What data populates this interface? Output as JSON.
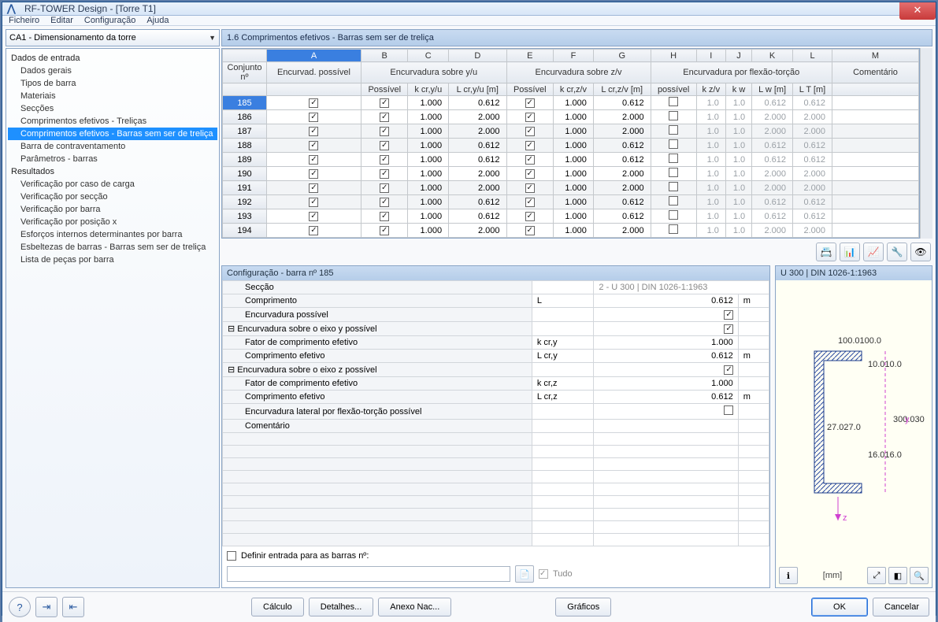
{
  "window": {
    "title": "RF-TOWER Design - [Torre T1]"
  },
  "menu": {
    "file": "Ficheiro",
    "edit": "Editar",
    "config": "Configuração",
    "help": "Ajuda"
  },
  "combo": {
    "value": "CA1 - Dimensionamento da torre"
  },
  "tree": {
    "input_header": "Dados de entrada",
    "results_header": "Resultados",
    "input_items": [
      "Dados gerais",
      "Tipos de barra",
      "Materiais",
      "Secções",
      "Comprimentos efetivos - Treliças",
      "Comprimentos efetivos - Barras sem ser de treliça",
      "Barra de contraventamento",
      "Parâmetros - barras"
    ],
    "input_selected_index": 5,
    "result_items": [
      "Verificação por caso de carga",
      "Verificação por secção",
      "Verificação por barra",
      "Verificação por posição x",
      "Esforços internos determinantes por barra",
      "Esbeltezas de barras - Barras sem ser de treliça",
      "Lista de peças por barra"
    ]
  },
  "grid": {
    "title": "1.6 Comprimentos efetivos - Barras sem ser de treliça",
    "col_letters": [
      "A",
      "B",
      "C",
      "D",
      "E",
      "F",
      "G",
      "H",
      "I",
      "J",
      "K",
      "L",
      "M"
    ],
    "group_headers": {
      "conjunto": "Conjunto nº",
      "encurvad": "Encurvad. possível",
      "yu": "Encurvadura sobre y/u",
      "zv": "Encurvadura sobre z/v",
      "ft": "Encurvadura por flexão-torção",
      "coment": "Comentário"
    },
    "sub_headers": {
      "possivel": "Possível",
      "k_yu": "k cr,y/u",
      "L_yu": "L cr,y/u [m]",
      "k_zv": "k cr,z/v",
      "L_zv": "L cr,z/v [m]",
      "poss_ft": "possível",
      "k_zv2": "k z/v",
      "k_w": "k w",
      "L_w": "L w [m]",
      "L_T": "L T [m]"
    },
    "rows": [
      {
        "n": "185",
        "a": true,
        "b": true,
        "c": "1.000",
        "d": "0.612",
        "e": true,
        "f": "1.000",
        "g": "0.612",
        "h": false,
        "i": "1.0",
        "j": "1.0",
        "k": "0.612",
        "l": "0.612"
      },
      {
        "n": "186",
        "a": true,
        "b": true,
        "c": "1.000",
        "d": "2.000",
        "e": true,
        "f": "1.000",
        "g": "2.000",
        "h": false,
        "i": "1.0",
        "j": "1.0",
        "k": "2.000",
        "l": "2.000"
      },
      {
        "n": "187",
        "a": true,
        "b": true,
        "c": "1.000",
        "d": "2.000",
        "e": true,
        "f": "1.000",
        "g": "2.000",
        "h": false,
        "i": "1.0",
        "j": "1.0",
        "k": "2.000",
        "l": "2.000"
      },
      {
        "n": "188",
        "a": true,
        "b": true,
        "c": "1.000",
        "d": "0.612",
        "e": true,
        "f": "1.000",
        "g": "0.612",
        "h": false,
        "i": "1.0",
        "j": "1.0",
        "k": "0.612",
        "l": "0.612"
      },
      {
        "n": "189",
        "a": true,
        "b": true,
        "c": "1.000",
        "d": "0.612",
        "e": true,
        "f": "1.000",
        "g": "0.612",
        "h": false,
        "i": "1.0",
        "j": "1.0",
        "k": "0.612",
        "l": "0.612"
      },
      {
        "n": "190",
        "a": true,
        "b": true,
        "c": "1.000",
        "d": "2.000",
        "e": true,
        "f": "1.000",
        "g": "2.000",
        "h": false,
        "i": "1.0",
        "j": "1.0",
        "k": "2.000",
        "l": "2.000"
      },
      {
        "n": "191",
        "a": true,
        "b": true,
        "c": "1.000",
        "d": "2.000",
        "e": true,
        "f": "1.000",
        "g": "2.000",
        "h": false,
        "i": "1.0",
        "j": "1.0",
        "k": "2.000",
        "l": "2.000"
      },
      {
        "n": "192",
        "a": true,
        "b": true,
        "c": "1.000",
        "d": "0.612",
        "e": true,
        "f": "1.000",
        "g": "0.612",
        "h": false,
        "i": "1.0",
        "j": "1.0",
        "k": "0.612",
        "l": "0.612"
      },
      {
        "n": "193",
        "a": true,
        "b": true,
        "c": "1.000",
        "d": "0.612",
        "e": true,
        "f": "1.000",
        "g": "0.612",
        "h": false,
        "i": "1.0",
        "j": "1.0",
        "k": "0.612",
        "l": "0.612"
      },
      {
        "n": "194",
        "a": true,
        "b": true,
        "c": "1.000",
        "d": "2.000",
        "e": true,
        "f": "1.000",
        "g": "2.000",
        "h": false,
        "i": "1.0",
        "j": "1.0",
        "k": "2.000",
        "l": "2.000"
      }
    ]
  },
  "config": {
    "title": "Configuração - barra nº 185",
    "rows": {
      "seccao_l": "Secção",
      "seccao_v": "2 - U 300 | DIN 1026-1:1963",
      "comprim_l": "Comprimento",
      "comprim_s": "L",
      "comprim_v": "0.612",
      "comprim_u": "m",
      "encposs_l": "Encurvadura possível",
      "ency_l": "Encurvadura sobre o eixo y possível",
      "fy_l": "Fator de comprimento efetivo",
      "fy_s": "k cr,y",
      "fy_v": "1.000",
      "cy_l": "Comprimento efetivo",
      "cy_s": "L cr,y",
      "cy_v": "0.612",
      "cy_u": "m",
      "encz_l": "Encurvadura sobre o eixo z possível",
      "fz_l": "Fator de comprimento efetivo",
      "fz_s": "k cr,z",
      "fz_v": "1.000",
      "cz_l": "Comprimento efetivo",
      "cz_s": "L cr,z",
      "cz_v": "0.612",
      "cz_u": "m",
      "lat_l": "Encurvadura lateral por flexão-torção possível",
      "com_l": "Comentário"
    },
    "define_label": "Definir entrada para as barras nº:",
    "tudo": "Tudo"
  },
  "section_view": {
    "title": "U 300 | DIN 1026-1:1963",
    "dims": {
      "w": "100.0",
      "tf": "10.0",
      "r": "27.0",
      "tw": "16.0",
      "h": "300.0"
    },
    "unit": "[mm]"
  },
  "buttons": {
    "calc": "Cálculo",
    "details": "Detalhes...",
    "annex": "Anexo Nac...",
    "graphs": "Gráficos",
    "ok": "OK",
    "cancel": "Cancelar"
  },
  "toolbar_icons": [
    "📇",
    "📊",
    "📈",
    "🔧",
    "👁"
  ]
}
